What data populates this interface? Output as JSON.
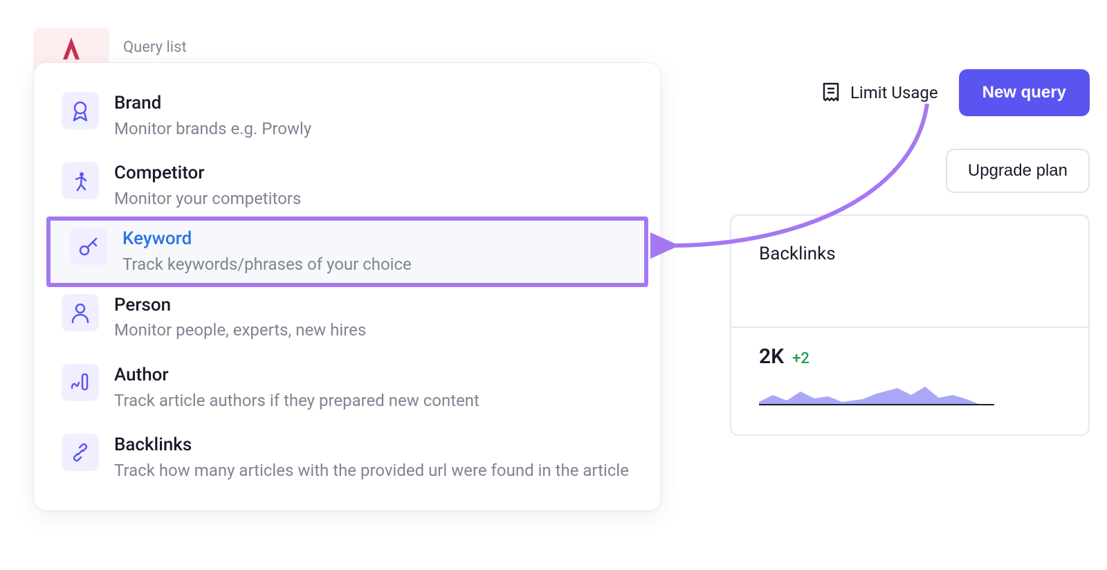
{
  "header": {
    "query_list_label": "Query list",
    "limit_usage_label": "Limit Usage",
    "new_query_label": "New query",
    "upgrade_label": "Upgrade plan"
  },
  "options": {
    "brand": {
      "title": "Brand",
      "desc": "Monitor brands e.g. Prowly"
    },
    "competitor": {
      "title": "Competitor",
      "desc": "Monitor your competitors"
    },
    "keyword": {
      "title": "Keyword",
      "desc": "Track keywords/phrases of your choice"
    },
    "person": {
      "title": "Person",
      "desc": "Monitor people, experts, new hires"
    },
    "author": {
      "title": "Author",
      "desc": "Track article authors if they prepared new content"
    },
    "backlinks": {
      "title": "Backlinks",
      "desc": "Track how many articles with the provided url were found in the article"
    }
  },
  "card": {
    "title": "Backlinks",
    "value": "2K",
    "delta": "+2"
  },
  "annotation": {
    "highlight_color": "#a578f3",
    "arrow_color": "#a578f3"
  }
}
